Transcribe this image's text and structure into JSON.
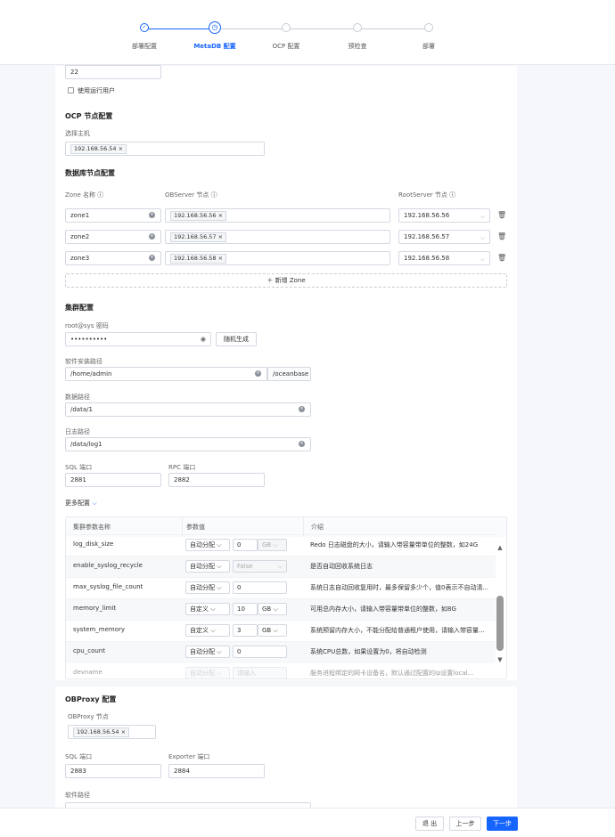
{
  "steps": [
    {
      "label": "部署配置",
      "state": "done"
    },
    {
      "label": "MetaDB 配置",
      "state": "active"
    },
    {
      "label": "OCP 配置",
      "state": "todo"
    },
    {
      "label": "预检查",
      "state": "todo"
    },
    {
      "label": "部署",
      "state": "todo"
    }
  ],
  "top_partial": {
    "port_value": "22",
    "use_run_user": "使用运行用户"
  },
  "ocp_node": {
    "title": "OCP 节点配置",
    "host_label": "选择主机",
    "host_tag": "192.168.56.54"
  },
  "db_node": {
    "title": "数据库节点配置",
    "col_zone": "Zone 名称",
    "col_observer": "OBServer 节点",
    "col_rootserver": "RootServer 节点",
    "zones": [
      {
        "name": "zone1",
        "observer": "192.168.56.56",
        "rootserver": "192.168.56.56"
      },
      {
        "name": "zone2",
        "observer": "192.168.56.57",
        "rootserver": "192.168.56.57"
      },
      {
        "name": "zone3",
        "observer": "192.168.56.58",
        "rootserver": "192.168.56.58"
      }
    ],
    "add_zone": "新增 Zone"
  },
  "cluster": {
    "title": "集群配置",
    "root_pwd_label": "root@sys 密码",
    "root_pwd_value": "••••••••••",
    "random_btn": "随机生成",
    "install_path_label": "软件安装路径",
    "install_path_value": "/home/admin",
    "install_path_suffix": "/oceanbase",
    "data_path_label": "数据路径",
    "data_path_value": "/data/1",
    "log_path_label": "日志路径",
    "log_path_value": "/data/log1",
    "sql_port_label": "SQL 端口",
    "sql_port_value": "2881",
    "rpc_port_label": "RPC 端口",
    "rpc_port_value": "2882",
    "more_label": "更多配置"
  },
  "params": {
    "col_name": "集群参数名称",
    "col_value": "参数值",
    "col_desc": "介绍",
    "rows": [
      {
        "name": "log_disk_size",
        "mode": "自动分配",
        "value": "0",
        "unit": "GB",
        "desc": "Redo 日志磁盘的大小，请输入带容量带单位的整数，如24G"
      },
      {
        "name": "enable_syslog_recycle",
        "mode": "自动分配",
        "value": "False",
        "unit": "",
        "desc": "是否自动回收系统日志"
      },
      {
        "name": "max_syslog_file_count",
        "mode": "自动分配",
        "value": "0",
        "unit": "",
        "desc": "系统日志自动回收复用时，最多保留多少个，值0表示不自动清..."
      },
      {
        "name": "memory_limit",
        "mode": "自定义",
        "value": "10",
        "unit": "GB",
        "desc": "可用总内存大小，请输入带容量带单位的整数，如8G"
      },
      {
        "name": "system_memory",
        "mode": "自定义",
        "value": "3",
        "unit": "GB",
        "desc": "系统预留内存大小，不能分配给普通租户使用，请输入带容量..."
      },
      {
        "name": "cpu_count",
        "mode": "自动分配",
        "value": "0",
        "unit": "",
        "desc": "系统CPU总数，如果设置为0，将自动检测"
      },
      {
        "name": "devname",
        "mode": "自动分配",
        "value": "请输入",
        "unit": "",
        "desc": "服务进程绑定的网卡设备名，默认通过配置的ip设置local..."
      }
    ]
  },
  "obproxy": {
    "title": "OBProxy 配置",
    "node_label": "OBProxy 节点",
    "node_tag": "192.168.56.54",
    "sql_port_label": "SQL 端口",
    "sql_port_value": "2883",
    "exporter_label": "Exporter 端口",
    "exporter_value": "2884",
    "path_label": "软件路径"
  },
  "footer": {
    "exit": "退 出",
    "prev": "上一步",
    "next": "下一步"
  },
  "colors": {
    "primary": "#1765ff",
    "border": "#d3d8e1"
  }
}
